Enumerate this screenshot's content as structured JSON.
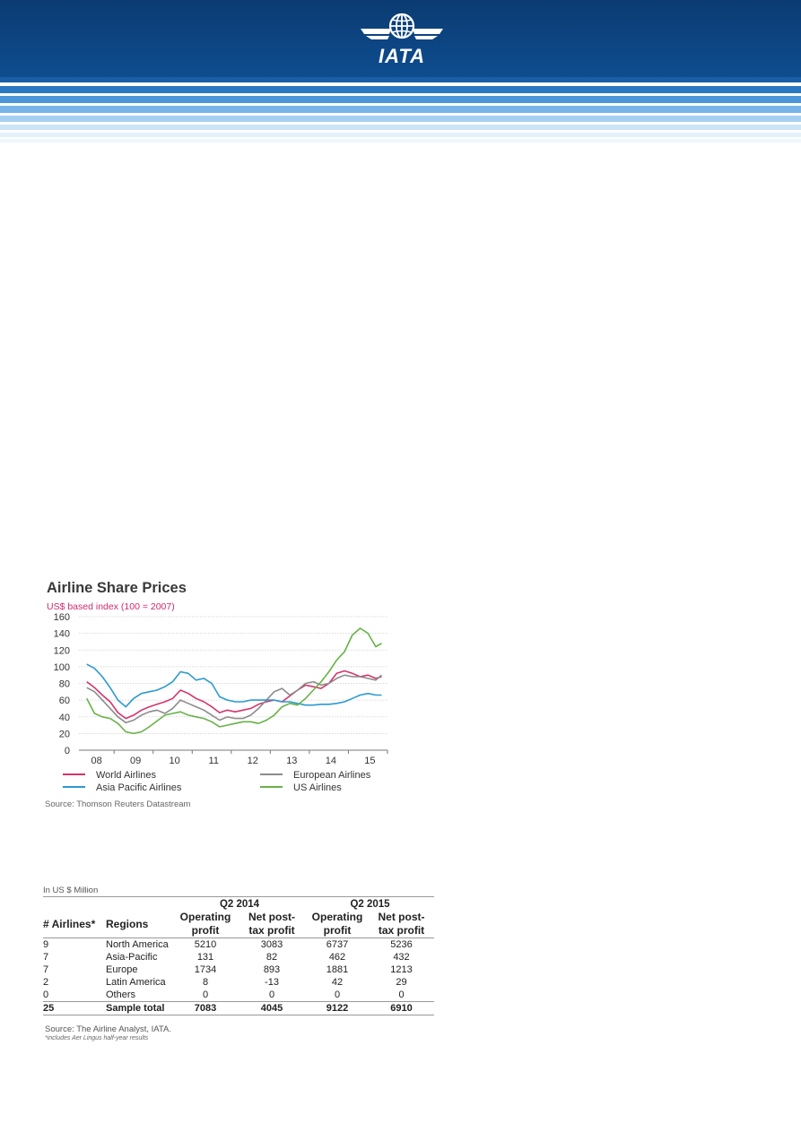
{
  "header": {
    "logo_text": "IATA"
  },
  "chart": {
    "title": "Airline Share Prices",
    "subtitle": "US$ based index (100 = 2007)",
    "source": "Source: Thomson Reuters Datastream"
  },
  "chart_data": {
    "type": "line",
    "title": "Airline Share Prices",
    "subtitle": "US$ based index (100 = 2007)",
    "ylim": [
      0,
      160
    ],
    "yticks": [
      0,
      20,
      40,
      60,
      80,
      100,
      120,
      140,
      160
    ],
    "xlim": [
      2007.6,
      2015.5
    ],
    "xtick_labels": [
      "08",
      "09",
      "10",
      "11",
      "12",
      "13",
      "14",
      "15"
    ],
    "xtick_positions": [
      2008.5,
      2009.5,
      2010.5,
      2011.5,
      2012.5,
      2013.5,
      2014.5,
      2015.5
    ],
    "grid": true,
    "legend": "bottom",
    "series": [
      {
        "name": "World Airlines",
        "color": "#d6336c",
        "x": [
          2007.8,
          2008.0,
          2008.2,
          2008.4,
          2008.6,
          2008.8,
          2009.0,
          2009.2,
          2009.4,
          2009.6,
          2009.8,
          2010.0,
          2010.2,
          2010.4,
          2010.6,
          2010.8,
          2011.0,
          2011.2,
          2011.4,
          2011.6,
          2011.8,
          2012.0,
          2012.2,
          2012.4,
          2012.6,
          2012.8,
          2013.0,
          2013.2,
          2013.4,
          2013.6,
          2013.8,
          2014.0,
          2014.2,
          2014.4,
          2014.6,
          2014.8,
          2015.0,
          2015.2,
          2015.35
        ],
        "y": [
          82,
          75,
          66,
          58,
          45,
          38,
          42,
          48,
          52,
          55,
          58,
          62,
          72,
          68,
          62,
          58,
          52,
          45,
          48,
          46,
          48,
          50,
          55,
          58,
          60,
          58,
          65,
          72,
          78,
          76,
          74,
          80,
          92,
          95,
          92,
          88,
          90,
          86,
          88
        ]
      },
      {
        "name": "European Airlines",
        "color": "#8c8c8c",
        "x": [
          2007.8,
          2008.0,
          2008.2,
          2008.4,
          2008.6,
          2008.8,
          2009.0,
          2009.2,
          2009.4,
          2009.6,
          2009.8,
          2010.0,
          2010.2,
          2010.4,
          2010.6,
          2010.8,
          2011.0,
          2011.2,
          2011.4,
          2011.6,
          2011.8,
          2012.0,
          2012.2,
          2012.4,
          2012.6,
          2012.8,
          2013.0,
          2013.2,
          2013.4,
          2013.6,
          2013.8,
          2014.0,
          2014.2,
          2014.4,
          2014.6,
          2014.8,
          2015.0,
          2015.2,
          2015.35
        ],
        "y": [
          75,
          70,
          60,
          50,
          40,
          33,
          36,
          42,
          46,
          48,
          44,
          50,
          60,
          56,
          52,
          48,
          42,
          36,
          40,
          38,
          38,
          42,
          50,
          60,
          70,
          74,
          66,
          72,
          80,
          82,
          78,
          80,
          86,
          90,
          88,
          88,
          86,
          84,
          90
        ]
      },
      {
        "name": "Asia Pacific Airlines",
        "color": "#2c9ad1",
        "x": [
          2007.8,
          2008.0,
          2008.2,
          2008.4,
          2008.6,
          2008.8,
          2009.0,
          2009.2,
          2009.4,
          2009.6,
          2009.8,
          2010.0,
          2010.2,
          2010.4,
          2010.6,
          2010.8,
          2011.0,
          2011.2,
          2011.4,
          2011.6,
          2011.8,
          2012.0,
          2012.2,
          2012.4,
          2012.6,
          2012.8,
          2013.0,
          2013.2,
          2013.4,
          2013.6,
          2013.8,
          2014.0,
          2014.2,
          2014.4,
          2014.6,
          2014.8,
          2015.0,
          2015.2,
          2015.35
        ],
        "y": [
          103,
          98,
          88,
          75,
          60,
          52,
          62,
          68,
          70,
          72,
          76,
          82,
          94,
          92,
          84,
          86,
          80,
          64,
          60,
          58,
          58,
          60,
          60,
          60,
          60,
          58,
          58,
          56,
          54,
          54,
          55,
          55,
          56,
          58,
          62,
          66,
          68,
          66,
          66
        ]
      },
      {
        "name": "US Airlines",
        "color": "#67b247",
        "x": [
          2007.8,
          2008.0,
          2008.2,
          2008.4,
          2008.6,
          2008.8,
          2009.0,
          2009.2,
          2009.4,
          2009.6,
          2009.8,
          2010.0,
          2010.2,
          2010.4,
          2010.6,
          2010.8,
          2011.0,
          2011.2,
          2011.4,
          2011.6,
          2011.8,
          2012.0,
          2012.2,
          2012.4,
          2012.6,
          2012.8,
          2013.0,
          2013.2,
          2013.4,
          2013.6,
          2013.8,
          2014.0,
          2014.2,
          2014.4,
          2014.6,
          2014.8,
          2015.0,
          2015.2,
          2015.35
        ],
        "y": [
          62,
          44,
          40,
          38,
          32,
          22,
          20,
          22,
          28,
          35,
          42,
          44,
          46,
          42,
          40,
          38,
          34,
          28,
          30,
          32,
          34,
          34,
          32,
          36,
          42,
          52,
          56,
          54,
          62,
          72,
          82,
          94,
          108,
          118,
          138,
          146,
          140,
          124,
          128
        ]
      }
    ]
  },
  "table": {
    "unit_note": "In US $ Million",
    "period_headers": [
      "Q2 2014",
      "Q2 2015"
    ],
    "col_headers": {
      "airlines": "# Airlines*",
      "regions": "Regions",
      "op_profit_line1": "Operating",
      "op_profit_line2": "profit",
      "net_profit_line1": "Net post-",
      "net_profit_line2": "tax profit"
    },
    "rows": [
      [
        "9",
        "North America",
        "5210",
        "3083",
        "6737",
        "5236"
      ],
      [
        "7",
        "Asia-Pacific",
        "131",
        "82",
        "462",
        "432"
      ],
      [
        "7",
        "Europe",
        "1734",
        "893",
        "1881",
        "1213"
      ],
      [
        "2",
        "Latin America",
        "8",
        "-13",
        "42",
        "29"
      ],
      [
        "0",
        "Others",
        "0",
        "0",
        "0",
        "0"
      ]
    ],
    "total": [
      "25",
      "Sample total",
      "7083",
      "4045",
      "9122",
      "6910"
    ],
    "source": "Source: The Airline Analyst, IATA.",
    "footnote": "*includes Aer Lingus half-year results"
  }
}
